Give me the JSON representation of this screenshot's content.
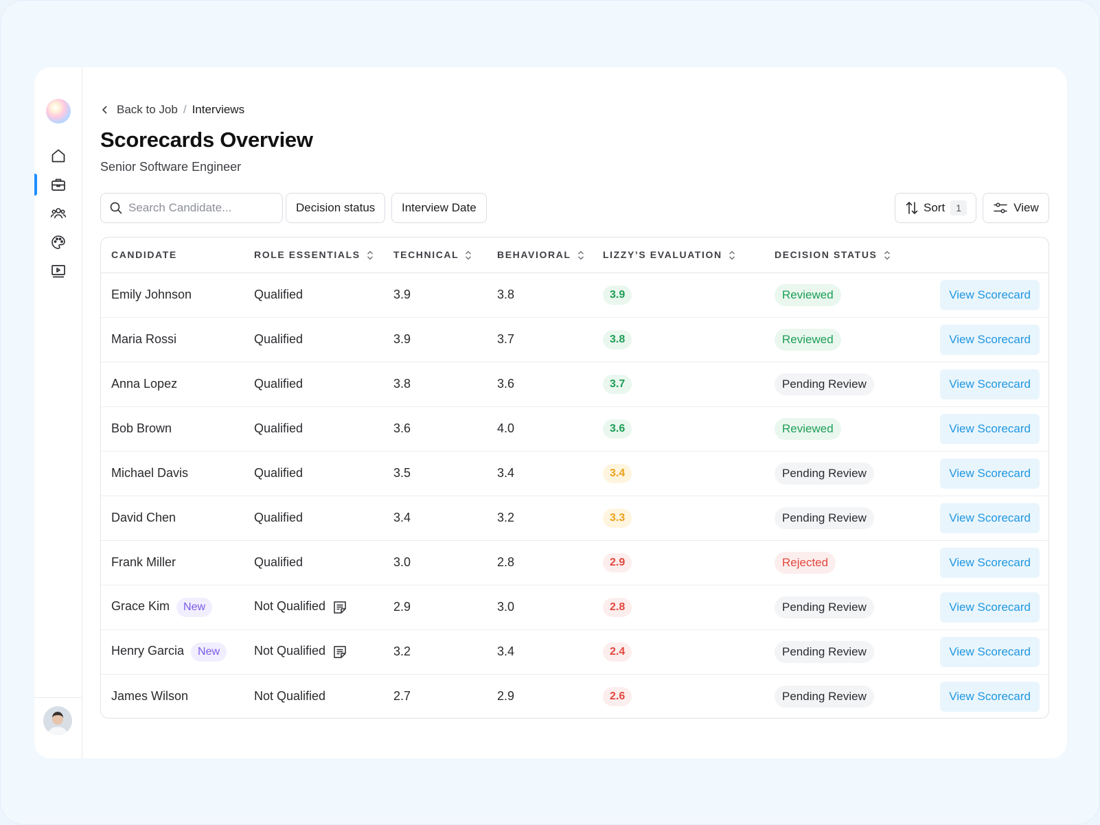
{
  "breadcrumb": {
    "back_label": "Back to Job",
    "separator": "/",
    "current": "Interviews"
  },
  "page": {
    "title": "Scorecards Overview",
    "subtitle": "Senior Software Engineer"
  },
  "toolbar": {
    "search_placeholder": "Search Candidate...",
    "filter_decision": "Decision status",
    "filter_date": "Interview Date",
    "sort_label": "Sort",
    "sort_count": "1",
    "view_label": "View"
  },
  "colors": {
    "accent": "#1f8fff",
    "score_green": "#1e9e55",
    "score_yellow": "#eca21c",
    "score_red": "#e2483d",
    "new_badge": "#7b5be6"
  },
  "table": {
    "headers": [
      "CANDIDATE",
      "ROLE ESSENTIALS",
      "TECHNICAL",
      "BEHAVIORAL",
      "LIZZY’S EVALUATION",
      "DECISION STATUS"
    ],
    "action_label": "View Scorecard",
    "rows": [
      {
        "name": "Emily Johnson",
        "is_new": false,
        "new_label": "",
        "role": "Qualified",
        "has_note": false,
        "technical": "3.9",
        "behavioral": "3.8",
        "evaluation": "3.9",
        "eval_level": "green",
        "status": "Reviewed",
        "status_kind": "reviewed"
      },
      {
        "name": "Maria Rossi",
        "is_new": false,
        "new_label": "",
        "role": "Qualified",
        "has_note": false,
        "technical": "3.9",
        "behavioral": "3.7",
        "evaluation": "3.8",
        "eval_level": "green",
        "status": "Reviewed",
        "status_kind": "reviewed"
      },
      {
        "name": "Anna Lopez",
        "is_new": false,
        "new_label": "",
        "role": "Qualified",
        "has_note": false,
        "technical": "3.8",
        "behavioral": "3.6",
        "evaluation": "3.7",
        "eval_level": "green",
        "status": "Pending Review",
        "status_kind": "pending"
      },
      {
        "name": "Bob Brown",
        "is_new": false,
        "new_label": "",
        "role": "Qualified",
        "has_note": false,
        "technical": "3.6",
        "behavioral": "4.0",
        "evaluation": "3.6",
        "eval_level": "green",
        "status": "Reviewed",
        "status_kind": "reviewed"
      },
      {
        "name": "Michael Davis",
        "is_new": false,
        "new_label": "",
        "role": "Qualified",
        "has_note": false,
        "technical": "3.5",
        "behavioral": "3.4",
        "evaluation": "3.4",
        "eval_level": "yellow",
        "status": "Pending Review",
        "status_kind": "pending"
      },
      {
        "name": "David Chen",
        "is_new": false,
        "new_label": "",
        "role": "Qualified",
        "has_note": false,
        "technical": "3.4",
        "behavioral": "3.2",
        "evaluation": "3.3",
        "eval_level": "yellow",
        "status": "Pending Review",
        "status_kind": "pending"
      },
      {
        "name": "Frank Miller",
        "is_new": false,
        "new_label": "",
        "role": "Qualified",
        "has_note": false,
        "technical": "3.0",
        "behavioral": "2.8",
        "evaluation": "2.9",
        "eval_level": "red",
        "status": "Rejected",
        "status_kind": "rejected"
      },
      {
        "name": "Grace Kim",
        "is_new": true,
        "new_label": "New",
        "role": "Not Qualified",
        "has_note": true,
        "technical": "2.9",
        "behavioral": "3.0",
        "evaluation": "2.8",
        "eval_level": "red",
        "status": "Pending Review",
        "status_kind": "pending"
      },
      {
        "name": "Henry Garcia",
        "is_new": true,
        "new_label": "New",
        "role": "Not Qualified",
        "has_note": true,
        "technical": "3.2",
        "behavioral": "3.4",
        "evaluation": "2.4",
        "eval_level": "red",
        "status": "Pending Review",
        "status_kind": "pending"
      },
      {
        "name": "James Wilson",
        "is_new": false,
        "new_label": "",
        "role": "Not Qualified",
        "has_note": false,
        "technical": "2.7",
        "behavioral": "2.9",
        "evaluation": "2.6",
        "eval_level": "red",
        "status": "Pending Review",
        "status_kind": "pending"
      }
    ]
  },
  "sidebar": {
    "items": [
      {
        "icon": "home-icon",
        "active": false
      },
      {
        "icon": "briefcase-icon",
        "active": true
      },
      {
        "icon": "users-icon",
        "active": false
      },
      {
        "icon": "palette-icon",
        "active": false
      },
      {
        "icon": "video-icon",
        "active": false
      }
    ]
  }
}
